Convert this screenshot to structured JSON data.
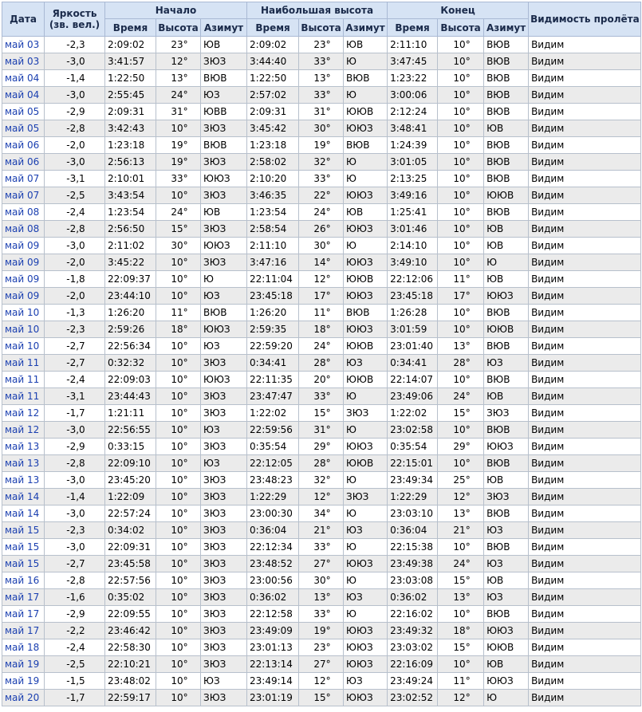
{
  "headers": {
    "date": "Дата",
    "brightness": "Яркость",
    "brightness_unit": "(зв. вел.)",
    "start": "Начало",
    "max": "Наибольшая высота",
    "end": "Конец",
    "visibility": "Видимость пролёта",
    "time": "Время",
    "altitude": "Высота",
    "azimuth": "Азимут"
  },
  "rows": [
    [
      "май 03",
      "-2,3",
      "2:09:02",
      "23°",
      "ЮВ",
      "2:09:02",
      "23°",
      "ЮВ",
      "2:11:10",
      "10°",
      "ВЮВ",
      "Видим"
    ],
    [
      "май 03",
      "-3,0",
      "3:41:57",
      "12°",
      "ЗЮЗ",
      "3:44:40",
      "33°",
      "Ю",
      "3:47:45",
      "10°",
      "ВЮВ",
      "Видим"
    ],
    [
      "май 04",
      "-1,4",
      "1:22:50",
      "13°",
      "ВЮВ",
      "1:22:50",
      "13°",
      "ВЮВ",
      "1:23:22",
      "10°",
      "ВЮВ",
      "Видим"
    ],
    [
      "май 04",
      "-3,0",
      "2:55:45",
      "24°",
      "ЮЗ",
      "2:57:02",
      "33°",
      "Ю",
      "3:00:06",
      "10°",
      "ВЮВ",
      "Видим"
    ],
    [
      "май 05",
      "-2,9",
      "2:09:31",
      "31°",
      "ЮВВ",
      "2:09:31",
      "31°",
      "ЮЮВ",
      "2:12:24",
      "10°",
      "ВЮВ",
      "Видим"
    ],
    [
      "май 05",
      "-2,8",
      "3:42:43",
      "10°",
      "ЗЮЗ",
      "3:45:42",
      "30°",
      "ЮЮЗ",
      "3:48:41",
      "10°",
      "ЮВ",
      "Видим"
    ],
    [
      "май 06",
      "-2,0",
      "1:23:18",
      "19°",
      "ВЮВ",
      "1:23:18",
      "19°",
      "ВЮВ",
      "1:24:39",
      "10°",
      "ВЮВ",
      "Видим"
    ],
    [
      "май 06",
      "-3,0",
      "2:56:13",
      "19°",
      "ЗЮЗ",
      "2:58:02",
      "32°",
      "Ю",
      "3:01:05",
      "10°",
      "ВЮВ",
      "Видим"
    ],
    [
      "май 07",
      "-3,1",
      "2:10:01",
      "33°",
      "ЮЮЗ",
      "2:10:20",
      "33°",
      "Ю",
      "2:13:25",
      "10°",
      "ВЮВ",
      "Видим"
    ],
    [
      "май 07",
      "-2,5",
      "3:43:54",
      "10°",
      "ЗЮЗ",
      "3:46:35",
      "22°",
      "ЮЮЗ",
      "3:49:16",
      "10°",
      "ЮЮВ",
      "Видим"
    ],
    [
      "май 08",
      "-2,4",
      "1:23:54",
      "24°",
      "ЮВ",
      "1:23:54",
      "24°",
      "ЮВ",
      "1:25:41",
      "10°",
      "ВЮВ",
      "Видим"
    ],
    [
      "май 08",
      "-2,8",
      "2:56:50",
      "15°",
      "ЗЮЗ",
      "2:58:54",
      "26°",
      "ЮЮЗ",
      "3:01:46",
      "10°",
      "ЮВ",
      "Видим"
    ],
    [
      "май 09",
      "-3,0",
      "2:11:02",
      "30°",
      "ЮЮЗ",
      "2:11:10",
      "30°",
      "Ю",
      "2:14:10",
      "10°",
      "ЮВ",
      "Видим"
    ],
    [
      "май 09",
      "-2,0",
      "3:45:22",
      "10°",
      "ЗЮЗ",
      "3:47:16",
      "14°",
      "ЮЮЗ",
      "3:49:10",
      "10°",
      "Ю",
      "Видим"
    ],
    [
      "май 09",
      "-1,8",
      "22:09:37",
      "10°",
      "Ю",
      "22:11:04",
      "12°",
      "ЮЮВ",
      "22:12:06",
      "11°",
      "ЮВ",
      "Видим"
    ],
    [
      "май 09",
      "-2,0",
      "23:44:10",
      "10°",
      "ЮЗ",
      "23:45:18",
      "17°",
      "ЮЮЗ",
      "23:45:18",
      "17°",
      "ЮЮЗ",
      "Видим"
    ],
    [
      "май 10",
      "-1,3",
      "1:26:20",
      "11°",
      "ВЮВ",
      "1:26:20",
      "11°",
      "ВЮВ",
      "1:26:28",
      "10°",
      "ВЮВ",
      "Видим"
    ],
    [
      "май 10",
      "-2,3",
      "2:59:26",
      "18°",
      "ЮЮЗ",
      "2:59:35",
      "18°",
      "ЮЮЗ",
      "3:01:59",
      "10°",
      "ЮЮВ",
      "Видим"
    ],
    [
      "май 10",
      "-2,7",
      "22:56:34",
      "10°",
      "ЮЗ",
      "22:59:20",
      "24°",
      "ЮЮВ",
      "23:01:40",
      "13°",
      "ВЮВ",
      "Видим"
    ],
    [
      "май 11",
      "-2,7",
      "0:32:32",
      "10°",
      "ЗЮЗ",
      "0:34:41",
      "28°",
      "ЮЗ",
      "0:34:41",
      "28°",
      "ЮЗ",
      "Видим"
    ],
    [
      "май 11",
      "-2,4",
      "22:09:03",
      "10°",
      "ЮЮЗ",
      "22:11:35",
      "20°",
      "ЮЮВ",
      "22:14:07",
      "10°",
      "ВЮВ",
      "Видим"
    ],
    [
      "май 11",
      "-3,1",
      "23:44:43",
      "10°",
      "ЗЮЗ",
      "23:47:47",
      "33°",
      "Ю",
      "23:49:06",
      "24°",
      "ЮВ",
      "Видим"
    ],
    [
      "май 12",
      "-1,7",
      "1:21:11",
      "10°",
      "ЗЮЗ",
      "1:22:02",
      "15°",
      "ЗЮЗ",
      "1:22:02",
      "15°",
      "ЗЮЗ",
      "Видим"
    ],
    [
      "май 12",
      "-3,0",
      "22:56:55",
      "10°",
      "ЮЗ",
      "22:59:56",
      "31°",
      "Ю",
      "23:02:58",
      "10°",
      "ВЮВ",
      "Видим"
    ],
    [
      "май 13",
      "-2,9",
      "0:33:15",
      "10°",
      "ЗЮЗ",
      "0:35:54",
      "29°",
      "ЮЮЗ",
      "0:35:54",
      "29°",
      "ЮЮЗ",
      "Видим"
    ],
    [
      "май 13",
      "-2,8",
      "22:09:10",
      "10°",
      "ЮЗ",
      "22:12:05",
      "28°",
      "ЮЮВ",
      "22:15:01",
      "10°",
      "ВЮВ",
      "Видим"
    ],
    [
      "май 13",
      "-3,0",
      "23:45:20",
      "10°",
      "ЗЮЗ",
      "23:48:23",
      "32°",
      "Ю",
      "23:49:34",
      "25°",
      "ЮВ",
      "Видим"
    ],
    [
      "май 14",
      "-1,4",
      "1:22:09",
      "10°",
      "ЗЮЗ",
      "1:22:29",
      "12°",
      "ЗЮЗ",
      "1:22:29",
      "12°",
      "ЗЮЗ",
      "Видим"
    ],
    [
      "май 14",
      "-3,0",
      "22:57:24",
      "10°",
      "ЗЮЗ",
      "23:00:30",
      "34°",
      "Ю",
      "23:03:10",
      "13°",
      "ВЮВ",
      "Видим"
    ],
    [
      "май 15",
      "-2,3",
      "0:34:02",
      "10°",
      "ЗЮЗ",
      "0:36:04",
      "21°",
      "ЮЗ",
      "0:36:04",
      "21°",
      "ЮЗ",
      "Видим"
    ],
    [
      "май 15",
      "-3,0",
      "22:09:31",
      "10°",
      "ЗЮЗ",
      "22:12:34",
      "33°",
      "Ю",
      "22:15:38",
      "10°",
      "ВЮВ",
      "Видим"
    ],
    [
      "май 15",
      "-2,7",
      "23:45:58",
      "10°",
      "ЗЮЗ",
      "23:48:52",
      "27°",
      "ЮЮЗ",
      "23:49:38",
      "24°",
      "ЮЗ",
      "Видим"
    ],
    [
      "май 16",
      "-2,8",
      "22:57:56",
      "10°",
      "ЗЮЗ",
      "23:00:56",
      "30°",
      "Ю",
      "23:03:08",
      "15°",
      "ЮВ",
      "Видим"
    ],
    [
      "май 17",
      "-1,6",
      "0:35:02",
      "10°",
      "ЗЮЗ",
      "0:36:02",
      "13°",
      "ЮЗ",
      "0:36:02",
      "13°",
      "ЮЗ",
      "Видим"
    ],
    [
      "май 17",
      "-2,9",
      "22:09:55",
      "10°",
      "ЗЮЗ",
      "22:12:58",
      "33°",
      "Ю",
      "22:16:02",
      "10°",
      "ВЮВ",
      "Видим"
    ],
    [
      "май 17",
      "-2,2",
      "23:46:42",
      "10°",
      "ЗЮЗ",
      "23:49:09",
      "19°",
      "ЮЮЗ",
      "23:49:32",
      "18°",
      "ЮЮЗ",
      "Видим"
    ],
    [
      "май 18",
      "-2,4",
      "22:58:30",
      "10°",
      "ЗЮЗ",
      "23:01:13",
      "23°",
      "ЮЮЗ",
      "23:03:02",
      "15°",
      "ЮЮВ",
      "Видим"
    ],
    [
      "май 19",
      "-2,5",
      "22:10:21",
      "10°",
      "ЗЮЗ",
      "22:13:14",
      "27°",
      "ЮЮЗ",
      "22:16:09",
      "10°",
      "ЮВ",
      "Видим"
    ],
    [
      "май 19",
      "-1,5",
      "23:48:02",
      "10°",
      "ЮЗ",
      "23:49:14",
      "12°",
      "ЮЗ",
      "23:49:24",
      "11°",
      "ЮЮЗ",
      "Видим"
    ],
    [
      "май 20",
      "-1,7",
      "22:59:17",
      "10°",
      "ЗЮЗ",
      "23:01:19",
      "15°",
      "ЮЮЗ",
      "23:02:52",
      "12°",
      "Ю",
      "Видим"
    ]
  ]
}
